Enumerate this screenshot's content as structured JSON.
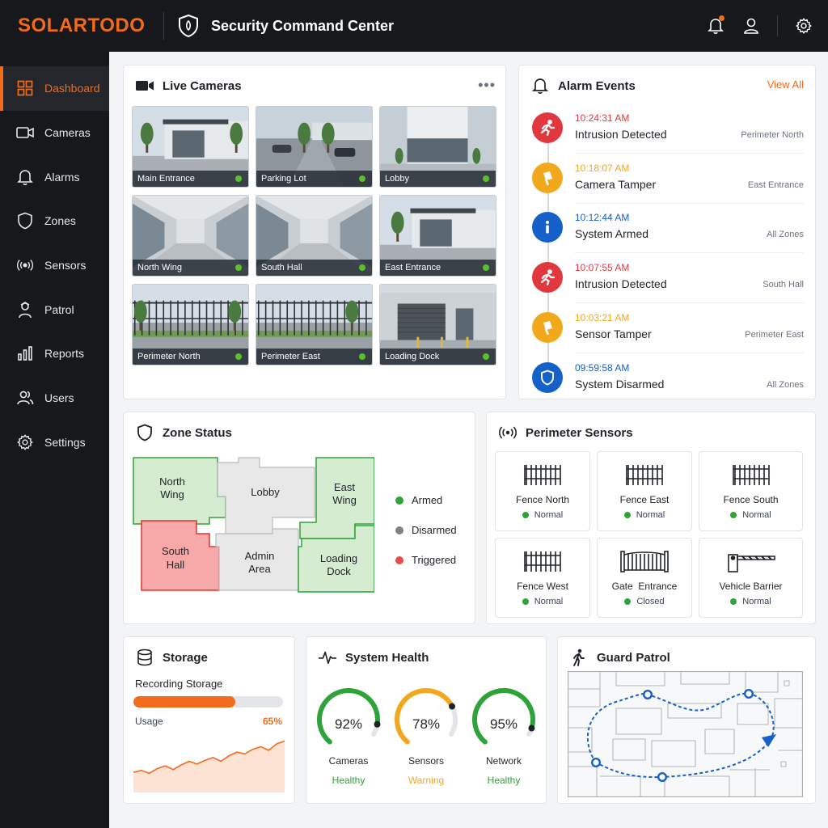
{
  "header": {
    "brand": "SOLARTODO",
    "title": "Security Command Center"
  },
  "sidebar": {
    "items": [
      {
        "label": "Dashboard",
        "icon": "grid-icon"
      },
      {
        "label": "Cameras",
        "icon": "camera-icon"
      },
      {
        "label": "Alarms",
        "icon": "bell-icon"
      },
      {
        "label": "Zones",
        "icon": "shield-icon"
      },
      {
        "label": "Sensors",
        "icon": "broadcast-icon"
      },
      {
        "label": "Patrol",
        "icon": "guard-icon"
      },
      {
        "label": "Reports",
        "icon": "bar-chart-icon"
      },
      {
        "label": "Users",
        "icon": "users-icon"
      },
      {
        "label": "Settings",
        "icon": "gear-icon"
      }
    ]
  },
  "cameras": {
    "title": "Live Cameras",
    "more": "•••",
    "feeds": [
      {
        "label": "Main Entrance",
        "status": "online"
      },
      {
        "label": "Parking Lot",
        "status": "online"
      },
      {
        "label": "Lobby",
        "status": "online"
      },
      {
        "label": "North Wing",
        "status": "online"
      },
      {
        "label": "South Hall",
        "status": "online"
      },
      {
        "label": "East Entrance",
        "status": "online"
      },
      {
        "label": "Perimeter North",
        "status": "online"
      },
      {
        "label": "Perimeter East",
        "status": "online"
      },
      {
        "label": "Loading Dock",
        "status": "online"
      }
    ]
  },
  "alarms": {
    "title": "Alarm Events",
    "view_all": "View All",
    "events": [
      {
        "time": "10:24:31 AM",
        "title": "Intrusion Detected",
        "location": "Perimeter North",
        "type": "intrusion",
        "color": "#e0383e"
      },
      {
        "time": "10:18:07 AM",
        "title": "Camera Tamper",
        "location": "East Entrance",
        "type": "tamper",
        "color": "#f2a81d"
      },
      {
        "time": "10:12:44 AM",
        "title": "System Armed",
        "location": "All Zones",
        "type": "info",
        "color": "#1560c9"
      },
      {
        "time": "10:07:55 AM",
        "title": "Intrusion Detected",
        "location": "South Hall",
        "type": "intrusion",
        "color": "#e0383e"
      },
      {
        "time": "10:03:21 AM",
        "title": "Sensor Tamper",
        "location": "Perimeter East",
        "type": "tamper",
        "color": "#f2a81d"
      },
      {
        "time": "09:59:58 AM",
        "title": "System Disarmed",
        "location": "All Zones",
        "type": "shield",
        "color": "#1560c9"
      }
    ]
  },
  "zones": {
    "title": "Zone Status",
    "areas": [
      {
        "l1": "North",
        "l2": "Wing",
        "state": "armed"
      },
      {
        "l1": "Lobby",
        "l2": "",
        "state": "disarmed"
      },
      {
        "l1": "East",
        "l2": "Wing",
        "state": "armed"
      },
      {
        "l1": "South",
        "l2": "Hall",
        "state": "triggered"
      },
      {
        "l1": "Admin",
        "l2": "Area",
        "state": "disarmed"
      },
      {
        "l1": "Loading",
        "l2": "Dock",
        "state": "armed"
      }
    ],
    "legend": [
      {
        "label": "Armed",
        "color": "#2fa23a"
      },
      {
        "label": "Disarmed",
        "color": "#7d8085"
      },
      {
        "label": "Triggered",
        "color": "#e94b4b"
      }
    ],
    "colors": {
      "armed": "#d6ecd0",
      "disarmed": "#e8e8e8",
      "triggered": "#f7a9a9"
    }
  },
  "sensors": {
    "title": "Perimeter Sensors",
    "items": [
      {
        "name": "Fence North",
        "status": "Normal",
        "icon": "fence-icon"
      },
      {
        "name": "Fence East",
        "status": "Normal",
        "icon": "fence-icon"
      },
      {
        "name": "Fence South",
        "status": "Normal",
        "icon": "fence-icon"
      },
      {
        "name": "Fence West",
        "status": "Normal",
        "icon": "fence-icon"
      },
      {
        "name": "Gate  Entrance",
        "status": "Closed",
        "icon": "gate-icon"
      },
      {
        "name": "Vehicle Barrier",
        "status": "Normal",
        "icon": "barrier-icon"
      }
    ]
  },
  "storage": {
    "title": "Storage",
    "label": "Recording Storage",
    "fill_percent": 68,
    "usage_label": "Usage",
    "usage_value": "65%",
    "trend": [
      22,
      24,
      21,
      26,
      29,
      25,
      30,
      34,
      31,
      35,
      38,
      34,
      40,
      44,
      42,
      47,
      50,
      46,
      53,
      56
    ]
  },
  "health": {
    "title": "System Health",
    "gauges": [
      {
        "value": "92%",
        "pct": 92,
        "name": "Cameras",
        "status": "Healthy",
        "color": "#2fa23a"
      },
      {
        "value": "78%",
        "pct": 78,
        "name": "Sensors",
        "status": "Warning",
        "color": "#f2a81d"
      },
      {
        "value": "95%",
        "pct": 95,
        "name": "Network",
        "status": "Healthy",
        "color": "#2fa23a"
      }
    ]
  },
  "patrol": {
    "title": "Guard Patrol",
    "route_color": "#1560c9"
  }
}
